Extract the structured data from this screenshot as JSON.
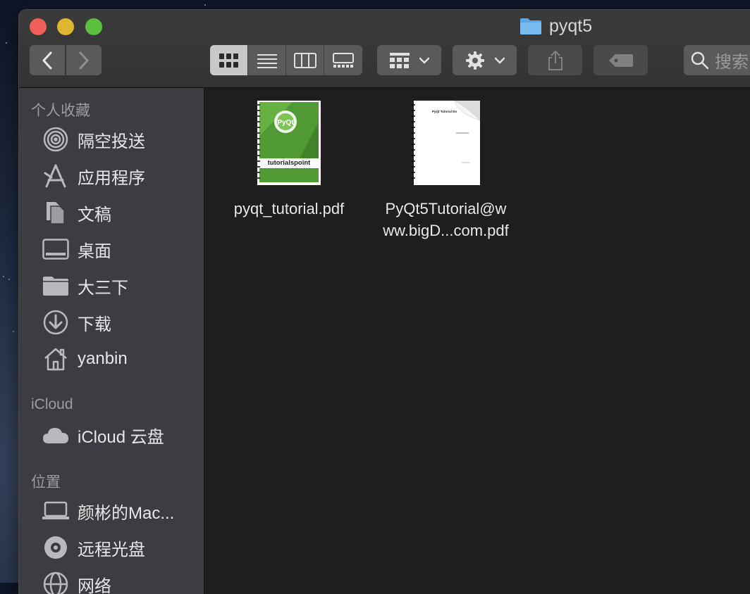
{
  "window": {
    "title": "pyqt5"
  },
  "toolbar": {
    "back_icon": "chevron-left-icon",
    "forward_icon": "chevron-right-icon",
    "view_modes": [
      "icon-view",
      "list-view",
      "column-view",
      "gallery-view"
    ],
    "active_view": "icon-view",
    "search_placeholder": "搜索"
  },
  "sidebar": {
    "favorites_title": "个人收藏",
    "favorites": [
      {
        "label": "隔空投送",
        "icon": "airdrop-icon"
      },
      {
        "label": "应用程序",
        "icon": "applications-icon"
      },
      {
        "label": "文稿",
        "icon": "documents-icon"
      },
      {
        "label": "桌面",
        "icon": "desktop-icon"
      },
      {
        "label": "大三下",
        "icon": "folder-icon"
      },
      {
        "label": "下载",
        "icon": "downloads-icon"
      },
      {
        "label": "yanbin",
        "icon": "home-icon"
      }
    ],
    "icloud_title": "iCloud",
    "icloud": [
      {
        "label": "iCloud 云盘",
        "icon": "cloud-icon"
      }
    ],
    "locations_title": "位置",
    "locations": [
      {
        "label": "颜彬的Mac...",
        "icon": "laptop-icon"
      },
      {
        "label": "远程光盘",
        "icon": "disc-icon"
      },
      {
        "label": "网络",
        "icon": "network-icon"
      }
    ]
  },
  "files": [
    {
      "name_line1": "pyqt_tutorial.pdf",
      "name_line2": "",
      "thumbnail": "pdf-green-cover",
      "cover_brand": "tutorialspoint",
      "cover_label": "PyQt"
    },
    {
      "name_line1": "PyQt5Tutorial@w",
      "name_line2": "ww.bigD...com.pdf",
      "thumbnail": "pdf-white-cover",
      "cover_label": "PyQt Tutorial Do"
    }
  ],
  "colors": {
    "close": "#ee5f57",
    "minimize": "#e0b630",
    "zoom": "#5bbf3f",
    "folder": "#5aa9e6",
    "cover_green": "#4f9a32"
  }
}
